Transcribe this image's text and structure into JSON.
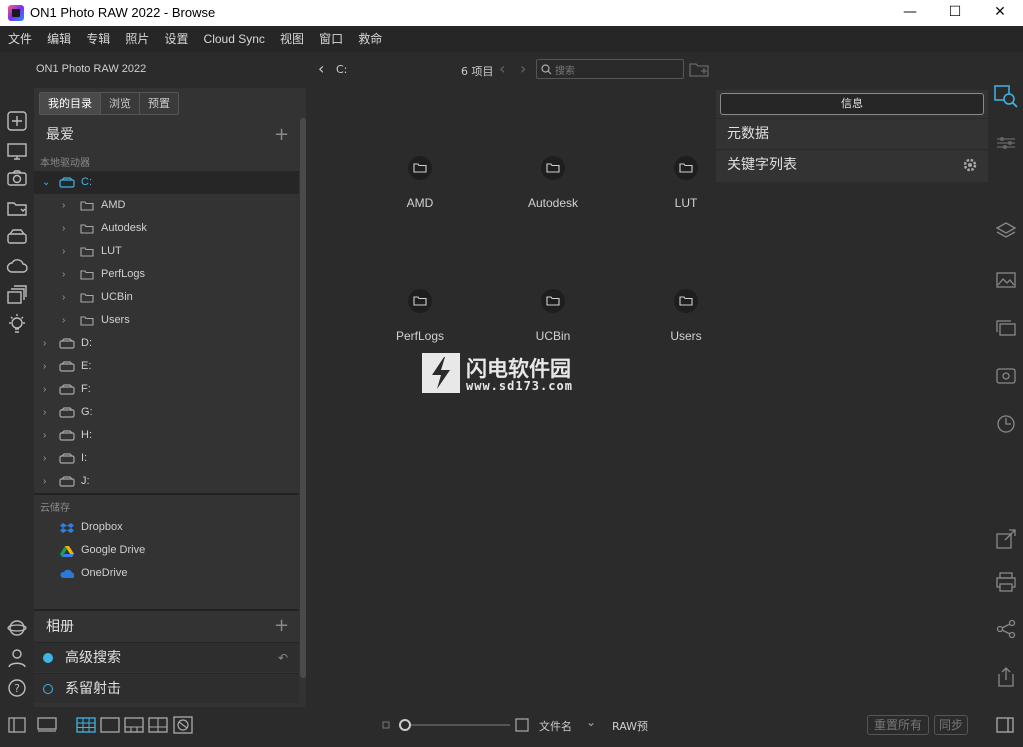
{
  "window": {
    "title": "ON1 Photo RAW 2022 - Browse",
    "minimize": "—",
    "maximize": "☐",
    "close": "✕"
  },
  "menu": [
    "文件",
    "编辑",
    "专辑",
    "照片",
    "设置",
    "Cloud Sync",
    "视图",
    "窗口",
    "救命"
  ],
  "app": {
    "name": "ON1 Photo RAW 2022"
  },
  "left_tabs": [
    "我的目录",
    "浏览",
    "预置"
  ],
  "favorites": {
    "title": "最爱",
    "subheader": "本地驱动器"
  },
  "drives": [
    {
      "label": "C:",
      "expanded": true,
      "children": [
        "AMD",
        "Autodesk",
        "LUT",
        "PerfLogs",
        "UCBin",
        "Users"
      ]
    },
    {
      "label": "D:"
    },
    {
      "label": "E:"
    },
    {
      "label": "F:"
    },
    {
      "label": "G:"
    },
    {
      "label": "H:"
    },
    {
      "label": "I:"
    },
    {
      "label": "J:"
    }
  ],
  "cloud": {
    "subheader": "云储存",
    "items": [
      "Dropbox",
      "Google Drive",
      "OneDrive"
    ]
  },
  "albums": {
    "title": "相册"
  },
  "smart": [
    {
      "label": "高级搜索",
      "color": "#3fb5e6"
    },
    {
      "label": "系留射击",
      "color": "#3fb5e6"
    }
  ],
  "nav": {
    "path": "C:",
    "count": "6 项目",
    "search_placeholder": "搜索"
  },
  "folders": [
    "AMD",
    "Autodesk",
    "LUT",
    "PerfLogs",
    "UCBin",
    "Users"
  ],
  "watermark": {
    "cn": "闪电软件园",
    "url": "www.sd173.com"
  },
  "right_panel": {
    "info_button": "信息",
    "rows": [
      "元数据",
      "关键字列表"
    ]
  },
  "bottom": {
    "sort_label": "文件名",
    "raw_label": "RAW预",
    "reset_all": "重置所有",
    "sync": "同步"
  },
  "accent": "#3fb5e6"
}
